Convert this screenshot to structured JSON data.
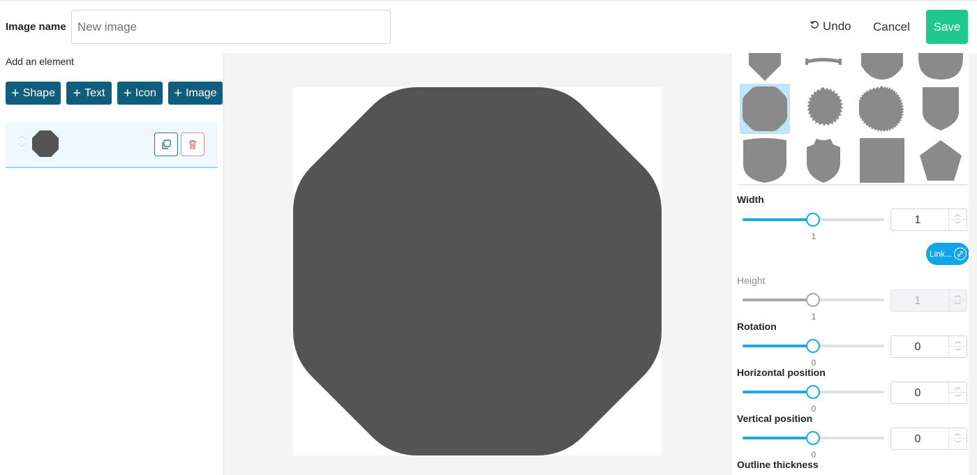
{
  "header": {
    "image_name_label": "Image name",
    "image_name_placeholder": "New image",
    "image_name_value": "",
    "undo_label": "Undo",
    "cancel_label": "Cancel",
    "save_label": "Save",
    "save_color": "#1ec88f"
  },
  "left_panel": {
    "add_label": "Add an element",
    "add_buttons": [
      "Shape",
      "Text",
      "Icon",
      "Image"
    ],
    "button_color": "#0f5e7e",
    "layers": [
      {
        "type": "octagon",
        "color": "#545454",
        "selected": true
      }
    ]
  },
  "canvas": {
    "background": "#ffffff",
    "shape": {
      "type": "octagon",
      "fill": "#545454"
    }
  },
  "right_panel": {
    "shapes": [
      "shield-pointed",
      "banner-ribbon",
      "shield-rounded",
      "shield-round-bottom",
      "octagon",
      "starburst-small",
      "starburst-large",
      "shield-classic",
      "shield-tall",
      "shield-crest",
      "square",
      "pentagon"
    ],
    "selected_shape": "octagon",
    "properties": {
      "width": {
        "label": "Width",
        "value": "1",
        "slider_label": "1",
        "disabled": false,
        "position": 0.5
      },
      "link_label": "Link...",
      "height": {
        "label": "Height",
        "value": "1",
        "slider_label": "1",
        "disabled": true,
        "position": 0.5
      },
      "rotation": {
        "label": "Rotation",
        "value": "0",
        "slider_label": "0",
        "disabled": false,
        "position": 0.5
      },
      "horizontal": {
        "label": "Horizontal position",
        "value": "0",
        "slider_label": "0",
        "disabled": false,
        "position": 0.5
      },
      "vertical": {
        "label": "Vertical position",
        "value": "0",
        "slider_label": "0",
        "disabled": false,
        "position": 0.5
      },
      "outline": {
        "label": "Outline thickness"
      }
    },
    "accent_color": "#1aa8e8"
  }
}
